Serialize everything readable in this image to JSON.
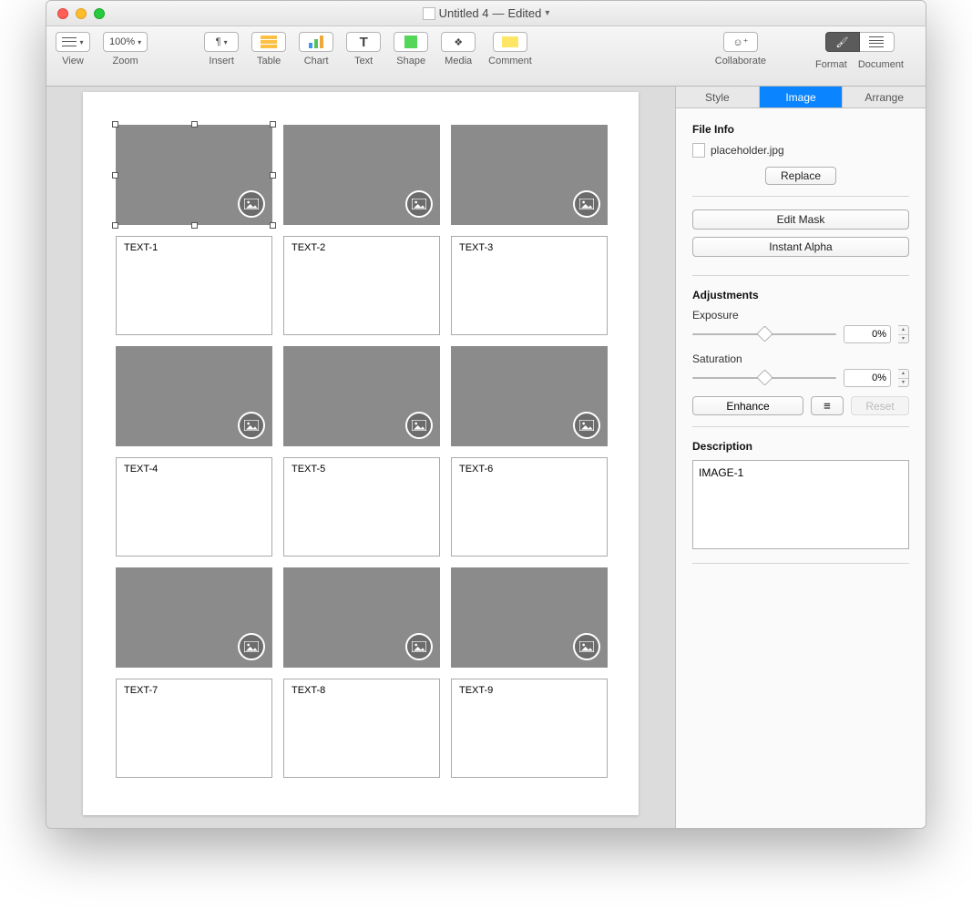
{
  "window": {
    "title": "Untitled 4",
    "state": "Edited"
  },
  "toolbar": {
    "view_label": "View",
    "zoom_label": "Zoom",
    "zoom_value": "100%",
    "insert_label": "Insert",
    "table_label": "Table",
    "chart_label": "Chart",
    "text_label": "Text",
    "shape_label": "Shape",
    "media_label": "Media",
    "comment_label": "Comment",
    "collaborate_label": "Collaborate",
    "format_label": "Format",
    "document_label": "Document"
  },
  "cells": {
    "t1": "TEXT-1",
    "t2": "TEXT-2",
    "t3": "TEXT-3",
    "t4": "TEXT-4",
    "t5": "TEXT-5",
    "t6": "TEXT-6",
    "t7": "TEXT-7",
    "t8": "TEXT-8",
    "t9": "TEXT-9"
  },
  "inspector": {
    "tabs": {
      "style": "Style",
      "image": "Image",
      "arrange": "Arrange"
    },
    "file_info_heading": "File Info",
    "filename": "placeholder.jpg",
    "replace_btn": "Replace",
    "edit_mask_btn": "Edit Mask",
    "instant_alpha_btn": "Instant Alpha",
    "adjustments_heading": "Adjustments",
    "exposure_label": "Exposure",
    "exposure_value": "0%",
    "saturation_label": "Saturation",
    "saturation_value": "0%",
    "enhance_btn": "Enhance",
    "reset_btn": "Reset",
    "description_heading": "Description",
    "description_value": "IMAGE-1"
  }
}
